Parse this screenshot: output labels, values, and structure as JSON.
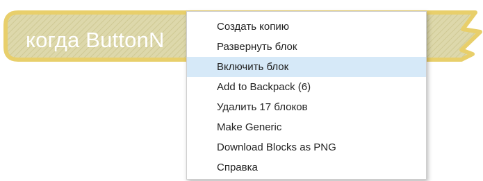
{
  "block": {
    "text": "когда ButtonN",
    "fill_color": "#ddd8ab",
    "border_color": "#e8cf6b",
    "text_color": "#ffffff"
  },
  "context_menu": {
    "highlight_color": "#d6e9f8",
    "items": [
      {
        "label": "Создать копию",
        "highlighted": false
      },
      {
        "label": "Развернуть блок",
        "highlighted": false
      },
      {
        "label": "Включить блок",
        "highlighted": true
      },
      {
        "label": "Add to Backpack (6)",
        "highlighted": false
      },
      {
        "label": "Удалить 17 блоков",
        "highlighted": false
      },
      {
        "label": "Make Generic",
        "highlighted": false
      },
      {
        "label": "Download Blocks as PNG",
        "highlighted": false
      },
      {
        "label": "Справка",
        "highlighted": false
      }
    ]
  }
}
